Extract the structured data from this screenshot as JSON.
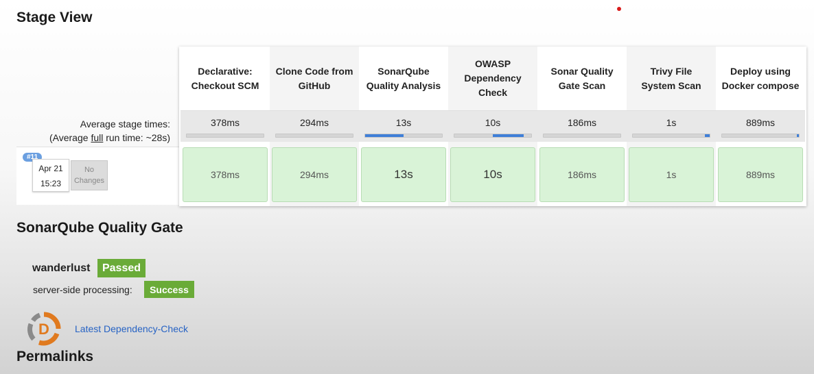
{
  "page": {
    "stage_view_title": "Stage View",
    "quality_gate_title": "SonarQube Quality Gate",
    "permalinks_title": "Permalinks"
  },
  "avg": {
    "line1": "Average stage times:",
    "line2_prefix": "(Average ",
    "line2_full": "full",
    "line2_suffix": " run time: ~28s)"
  },
  "stages": [
    {
      "name": "Declarative: Checkout SCM",
      "avg": "378ms",
      "cell": "378ms",
      "progress": 0.0
    },
    {
      "name": "Clone Code from GitHub",
      "avg": "294ms",
      "cell": "294ms",
      "progress": 0.0
    },
    {
      "name": "SonarQube Quality Analysis",
      "avg": "13s",
      "cell": "13s",
      "progress": 0.5
    },
    {
      "name": "OWASP Dependency Check",
      "avg": "10s",
      "cell": "10s",
      "progress": 0.4
    },
    {
      "name": "Sonar Quality Gate Scan",
      "avg": "186ms",
      "cell": "186ms",
      "progress": 0.0
    },
    {
      "name": "Trivy File System Scan",
      "avg": "1s",
      "cell": "1s",
      "progress": 0.06
    },
    {
      "name": "Deploy using Docker compose",
      "avg": "889ms",
      "cell": "889ms",
      "progress": 0.03
    }
  ],
  "build": {
    "number": "#11",
    "date": "Apr 21",
    "time": "15:23",
    "changes": "No Changes"
  },
  "quality_gate": {
    "project": "wanderlust",
    "status": "Passed",
    "processing_label": "server-side processing:",
    "processing_status": "Success"
  },
  "dependency_check": {
    "link_label": "Latest Dependency-Check",
    "logo_letter": "D",
    "icon": "dependency-check-logo-icon"
  },
  "colors": {
    "success_green": "#6aab38",
    "stage_cell_green": "#d9f3d7",
    "progress_blue": "#3f7fd8",
    "link_blue": "#2763c4"
  }
}
